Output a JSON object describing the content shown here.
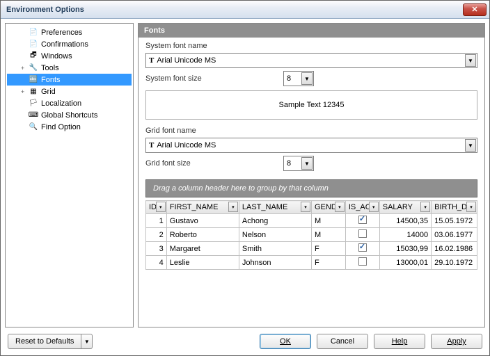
{
  "window": {
    "title": "Environment Options"
  },
  "tree": [
    {
      "label": "Preferences",
      "icon": "📄",
      "indent": 28
    },
    {
      "label": "Confirmations",
      "icon": "📄",
      "indent": 28
    },
    {
      "label": "Windows",
      "icon": "🗗",
      "indent": 28
    },
    {
      "label": "Tools",
      "icon": "🔧",
      "indent": 28,
      "expand": "+"
    },
    {
      "label": "Fonts",
      "icon": "🔤",
      "indent": 28,
      "selected": true
    },
    {
      "label": "Grid",
      "icon": "▦",
      "indent": 28,
      "expand": "+"
    },
    {
      "label": "Localization",
      "icon": "🏳",
      "indent": 28
    },
    {
      "label": "Global Shortcuts",
      "icon": "⌨",
      "indent": 28
    },
    {
      "label": "Find Option",
      "icon": "🔍",
      "indent": 28
    }
  ],
  "section": {
    "title": "Fonts"
  },
  "labels": {
    "sysFontName": "System font name",
    "sysFontSize": "System font size",
    "gridFontName": "Grid font name",
    "gridFontSize": "Grid font size",
    "sample": "Sample Text 12345",
    "groupHint": "Drag a column header here to group by that column"
  },
  "values": {
    "sysFontName": "Arial Unicode MS",
    "sysFontSize": "8",
    "gridFontName": "Arial Unicode MS",
    "gridFontSize": "8"
  },
  "grid": {
    "columns": [
      "ID",
      "FIRST_NAME",
      "LAST_NAME",
      "GEND",
      "IS_AC",
      "SALARY",
      "BIRTH_D"
    ],
    "rows": [
      {
        "id": "1",
        "first": "Gustavo",
        "last": "Achong",
        "gend": "M",
        "active": true,
        "salary": "14500,35",
        "birth": "15.05.1972"
      },
      {
        "id": "2",
        "first": "Roberto",
        "last": "Nelson",
        "gend": "M",
        "active": false,
        "salary": "14000",
        "birth": "03.06.1977"
      },
      {
        "id": "3",
        "first": "Margaret",
        "last": "Smith",
        "gend": "F",
        "active": true,
        "salary": "15030,99",
        "birth": "16.02.1986"
      },
      {
        "id": "4",
        "first": "Leslie",
        "last": "Johnson",
        "gend": "F",
        "active": false,
        "salary": "13000,01",
        "birth": "29.10.1972"
      }
    ]
  },
  "buttons": {
    "reset": "Reset to Defaults",
    "ok": "OK",
    "cancel": "Cancel",
    "help": "Help",
    "apply": "Apply"
  }
}
